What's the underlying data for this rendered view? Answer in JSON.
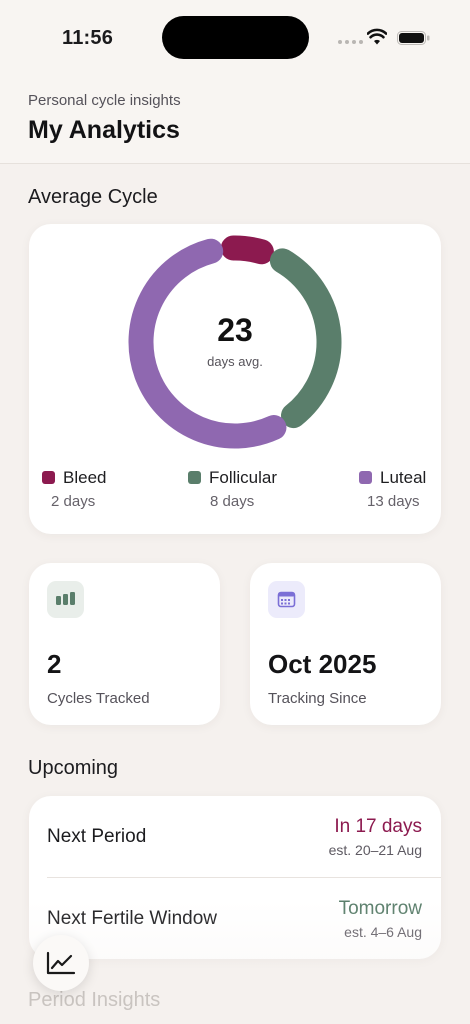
{
  "status_bar": {
    "time": "11:56"
  },
  "header": {
    "subtitle": "Personal cycle insights",
    "title": "My Analytics"
  },
  "average_cycle": {
    "section_title": "Average Cycle",
    "total_days": "23",
    "total_caption": "days avg.",
    "phases": [
      {
        "name": "Bleed",
        "days_label": "2 days",
        "days": 2,
        "color": "#8c1a4f"
      },
      {
        "name": "Follicular",
        "days_label": "8 days",
        "days": 8,
        "color": "#5a7e6b"
      },
      {
        "name": "Luteal",
        "days_label": "13 days",
        "days": 13,
        "color": "#8f68b0"
      }
    ]
  },
  "stats": [
    {
      "value": "2",
      "label": "Cycles Tracked",
      "icon": "bar-chart-icon",
      "icon_color": "#5a7e6b"
    },
    {
      "value": "Oct 2025",
      "label": "Tracking Since",
      "icon": "calendar-icon",
      "icon_color": "#7b6fd6"
    }
  ],
  "upcoming": {
    "section_title": "Upcoming",
    "items": [
      {
        "label": "Next Period",
        "value": "In 17 days",
        "sub": "est. 20–21 Aug",
        "color": "#8c1a4f"
      },
      {
        "label": "Next Fertile Window",
        "value": "Tomorrow",
        "sub": "est. 4–6 Aug",
        "color": "#5a7e6b"
      }
    ]
  },
  "next_section_title": "Period Insights",
  "fab_icon": "trend-chart-icon"
}
